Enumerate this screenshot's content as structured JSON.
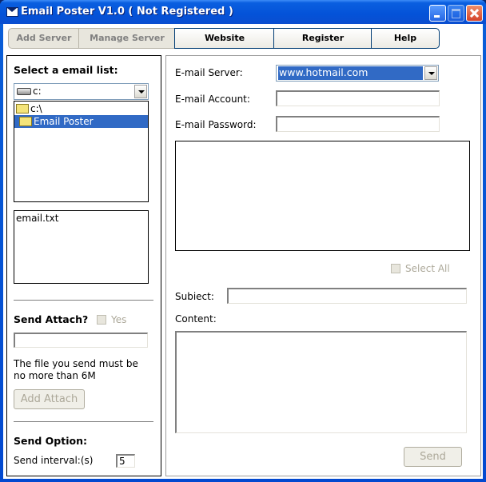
{
  "window": {
    "title": "Email Poster V1.0 ( Not Registered )",
    "controls": [
      "minimize",
      "maximize",
      "close"
    ]
  },
  "tabs": [
    {
      "label": "Add Server",
      "state": "inactive"
    },
    {
      "label": "Manage Server",
      "state": "inactive"
    },
    {
      "label": "Website",
      "state": "active"
    },
    {
      "label": "Register",
      "state": "active"
    },
    {
      "label": "Help",
      "state": "active"
    }
  ],
  "left": {
    "select_list_label": "Select a email list:",
    "drive_combo_value": "c:",
    "folder_tree": [
      {
        "label": "c:\\",
        "selected": false
      },
      {
        "label": "Email Poster",
        "selected": true
      }
    ],
    "files": [
      "email.txt"
    ],
    "send_attach_label": "Send Attach?",
    "attach_yes_label": "Yes",
    "attach_path_value": "",
    "attach_note_line1": "The file you send must be",
    "attach_note_line2": "no more than 6M",
    "add_attach_button": "Add Attach",
    "send_option_label": "Send Option:",
    "send_interval_label": "Send interval:(s)",
    "send_interval_value": "5"
  },
  "right": {
    "server_label": "E-mail Server:",
    "server_value": "www.hotmail.com",
    "account_label": "E-mail Account:",
    "account_value": "",
    "password_label": "E-mail Password:",
    "password_value": "",
    "recipients": [],
    "select_all_label": "Select All",
    "subject_label": "Subiect:",
    "subject_value": "",
    "content_label": "Content:",
    "content_value": "",
    "send_button": "Send"
  },
  "colors": {
    "title_bar": "#0452d8",
    "selection": "#316ac5",
    "disabled_text": "#aca899"
  }
}
